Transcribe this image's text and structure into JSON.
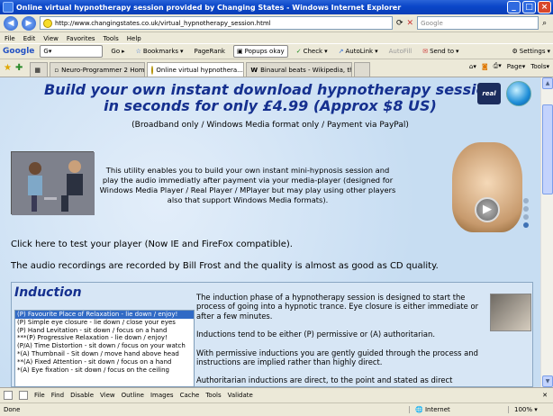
{
  "window": {
    "title": "Online virtual hypnotherapy session provided by Changing States - Windows Internet Explorer"
  },
  "address": {
    "url": "http://www.changingstates.co.uk/virtual_hypnotherapy_session.html",
    "search_placeholder": "Google"
  },
  "menu": [
    "File",
    "Edit",
    "View",
    "Favorites",
    "Tools",
    "Help"
  ],
  "google_toolbar": {
    "logo": "Google",
    "go": "Go",
    "bookmarks": "Bookmarks",
    "pagerank": "PageRank",
    "popups": "Popups okay",
    "check": "Check",
    "autolink": "AutoLink",
    "autofill": "AutoFill",
    "sendto": "Send to",
    "settings": "Settings"
  },
  "tabs": [
    {
      "label": "Neuro-Programmer 2 Home -..."
    },
    {
      "label": "Online virtual hypnothera..."
    },
    {
      "label": "Binaural beats - Wikipedia, th..."
    }
  ],
  "tab_tools": {
    "page": "Page",
    "tools": "Tools"
  },
  "page": {
    "headline1": "Build your own instant download hypnotherapy session",
    "headline2": "in seconds for only £4.99 (Approx $8 US)",
    "subtitle": "(Broadband only / Windows Media format only / Payment via PayPal)",
    "intro": "This utility enables you to build your own instant mini-hypnosis session and play the audio immediatly after payment via your media-player (designed for Windows Media Player / Real Player / MPlayer but may play using other players also that support Windows Media formats).",
    "real_logo": "real",
    "test_player": "Click here to test your player (Now IE and FireFox compatible).",
    "recordings": "The audio recordings are recorded by Bill Frost and the quality is almost as good as CD quality.",
    "induction_title": "Induction",
    "induction_items": [
      "(P) Favourite Place of Relaxation - lie down / enjoy!",
      "(P) Simple eye closure - lie down / close your eyes",
      "(P) Hand Levitation - sit down / focus on a hand",
      "***(P) Progressive Relaxation - lie down / enjoy!",
      "(P/A) Time Distortion - sit down / focus on your watch",
      "*(A) Thumbnail - Sit down / move hand above head",
      "**(A) Fixed Attention - sit down / focus on a hand",
      "*(A) Eye fixation - sit down / focus on the ceiling"
    ],
    "desc_p1": "The induction phase of a hypnotherapy session is designed to start the process of going into a hypnotic trance. Eye closure is either immediate or after a few minutes.",
    "desc_p2": "Inductions tend to be either (P) permissive or (A) authoritarian.",
    "desc_p3": "With permissive inductions you are gently guided through the process and instructions are implied rather than highly direct.",
    "desc_p4": "Authoritarian inductions are direct, to the point and stated as direct"
  },
  "devbar": [
    "File",
    "Find",
    "Disable",
    "View",
    "Outline",
    "Images",
    "Cache",
    "Tools",
    "Validate"
  ],
  "status": {
    "left": "Done",
    "zone": "Internet",
    "zoom": "100%"
  },
  "colors": {
    "headline": "#15308f",
    "page_bg": "#c7ddf2",
    "selected": "#316ac5"
  }
}
